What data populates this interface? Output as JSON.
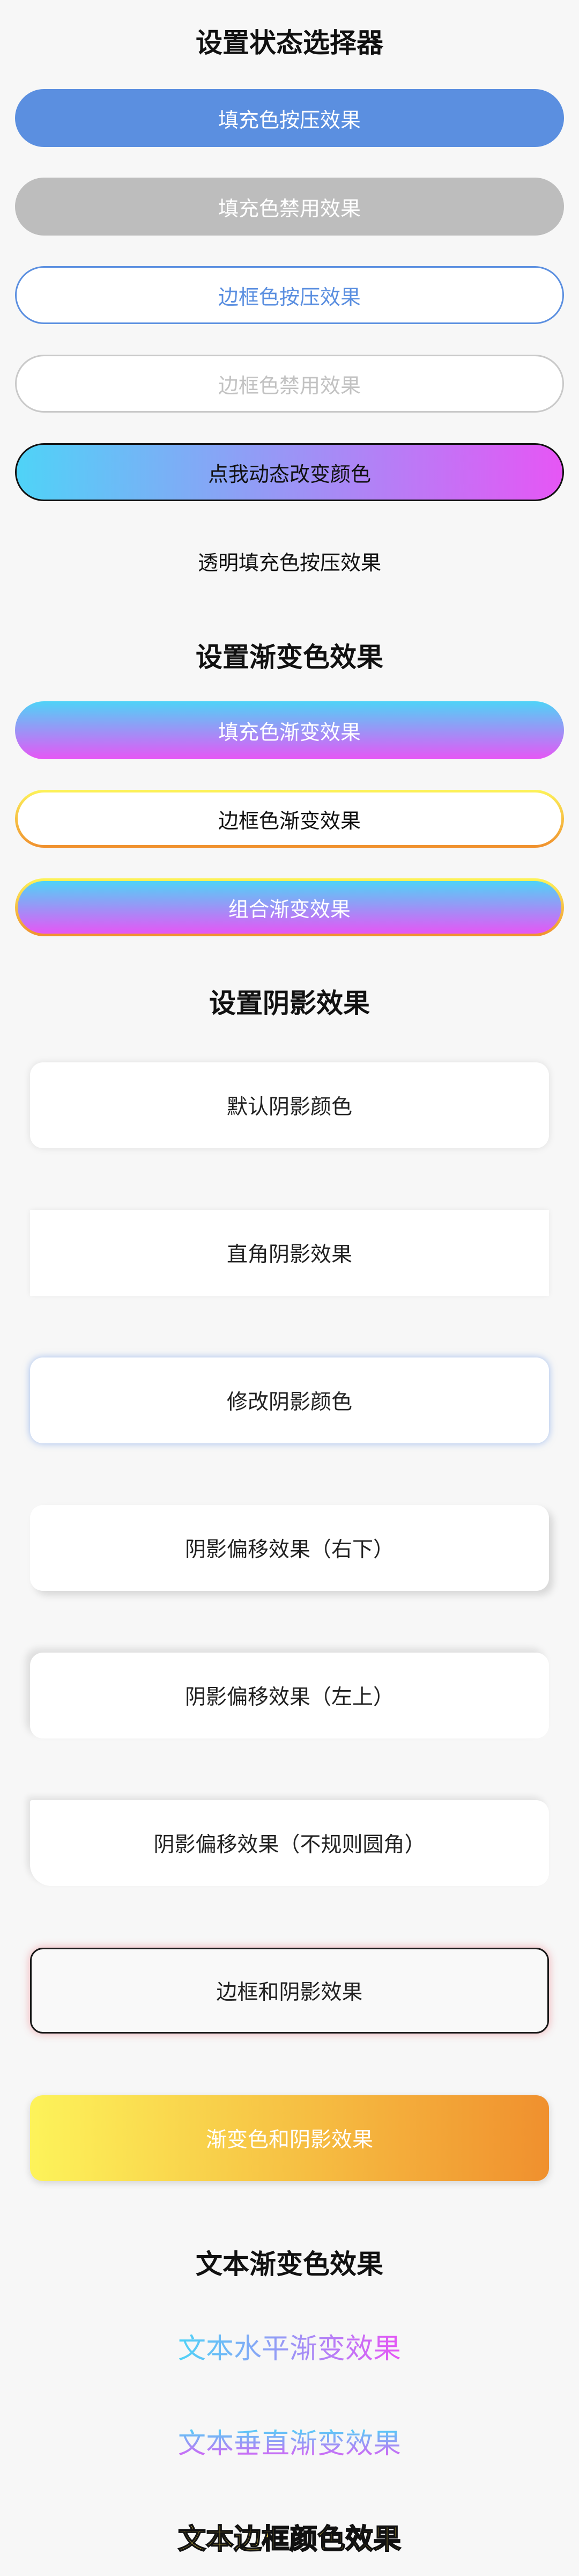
{
  "sections": {
    "state_selector": "设置状态选择器",
    "gradient": "设置渐变色效果",
    "shadow": "设置阴影效果",
    "text_gradient": "文本渐变色效果"
  },
  "state_buttons": {
    "fill_pressed": "填充色按压效果",
    "fill_disabled": "填充色禁用效果",
    "border_pressed": "边框色按压效果",
    "border_disabled": "边框色禁用效果",
    "dynamic_color": "点我动态改变颜色",
    "transparent_pressed": "透明填充色按压效果"
  },
  "gradient_buttons": {
    "fill_gradient": "填充色渐变效果",
    "border_gradient": "边框色渐变效果",
    "combined_gradient": "组合渐变效果"
  },
  "shadow_cards": {
    "default_shadow": "默认阴影颜色",
    "right_angle_shadow": "直角阴影效果",
    "modify_shadow_color": "修改阴影颜色",
    "offset_bottom_right": "阴影偏移效果（右下）",
    "offset_top_left": "阴影偏移效果（左上）",
    "offset_irregular": "阴影偏移效果（不规则圆角）",
    "border_and_shadow": "边框和阴影效果",
    "gradient_and_shadow": "渐变色和阴影效果"
  },
  "text_effects": {
    "horizontal": "文本水平渐变效果",
    "vertical": "文本垂直渐变效果",
    "stroke": "文本边框颜色效果"
  },
  "colors": {
    "background": "#f7f7f7",
    "primary_blue": "#5b8fe0",
    "disabled_gray": "#bdbdbd",
    "gradient_cyan": "#4fd3f7",
    "gradient_magenta": "#e656f5",
    "gradient_yellow": "#fdf35a",
    "gradient_orange": "#f0902e"
  }
}
